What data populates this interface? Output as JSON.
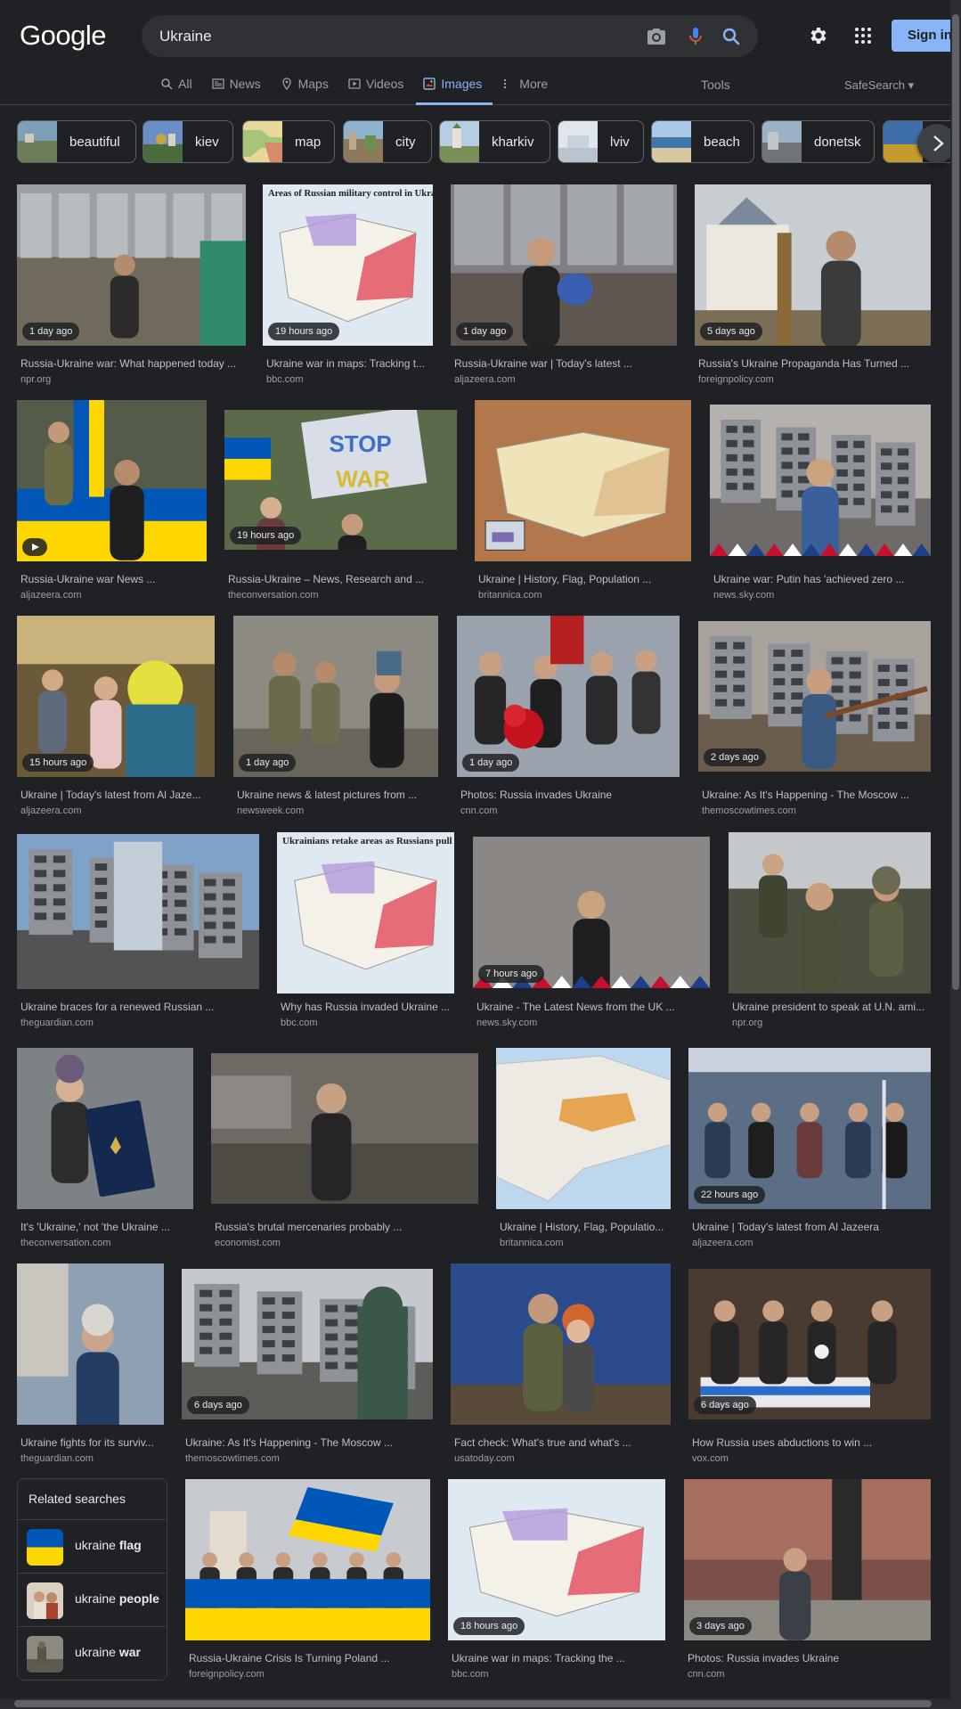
{
  "logo": "Google",
  "search": {
    "query": "Ukraine"
  },
  "header": {
    "signin_label": "Sign in",
    "tools_label": "Tools",
    "safesearch_label": "SafeSearch"
  },
  "tabs": [
    {
      "label": "All",
      "icon": "search-icon"
    },
    {
      "label": "News",
      "icon": "news-icon"
    },
    {
      "label": "Maps",
      "icon": "map-pin-icon"
    },
    {
      "label": "Videos",
      "icon": "video-icon"
    },
    {
      "label": "Images",
      "icon": "image-icon",
      "active": true
    },
    {
      "label": "More",
      "icon": "more-vert-icon"
    }
  ],
  "chips": [
    "beautiful",
    "kiev",
    "map",
    "city",
    "kharkiv",
    "lviv",
    "beach",
    "donetsk"
  ],
  "results": [
    {
      "title": "Russia-Ukraine war: What happened today ...",
      "domain": "npr.org",
      "badge": "1 day ago"
    },
    {
      "title": "Ukraine war in maps: Tracking t...",
      "domain": "bbc.com",
      "badge": "19 hours ago",
      "img_text": "Areas of Russian military control in Ukraine"
    },
    {
      "title": "Russia-Ukraine war | Today's latest ...",
      "domain": "aljazeera.com",
      "badge": "1 day ago"
    },
    {
      "title": "Russia's Ukraine Propaganda Has Turned ...",
      "domain": "foreignpolicy.com",
      "badge": "5 days ago"
    },
    {
      "title": "Russia-Ukraine war News ...",
      "domain": "aljazeera.com",
      "badge": ""
    },
    {
      "title": "Russia-Ukraine – News, Research and ...",
      "domain": "theconversation.com",
      "badge": "19 hours ago",
      "img_text": "STOP the WAR"
    },
    {
      "title": "Ukraine | History, Flag, Population ...",
      "domain": "britannica.com",
      "badge": ""
    },
    {
      "title": "Ukraine war: Putin has 'achieved zero ...",
      "domain": "news.sky.com",
      "badge": ""
    },
    {
      "title": "Ukraine | Today's latest from Al Jaze...",
      "domain": "aljazeera.com",
      "badge": "15 hours ago"
    },
    {
      "title": "Ukraine news & latest pictures from ...",
      "domain": "newsweek.com",
      "badge": "1 day ago"
    },
    {
      "title": "Photos: Russia invades Ukraine",
      "domain": "cnn.com",
      "badge": "1 day ago"
    },
    {
      "title": "Ukraine: As It's Happening - The Moscow ...",
      "domain": "themoscowtimes.com",
      "badge": "2 days ago"
    },
    {
      "title": "Ukraine braces for a renewed Russian ...",
      "domain": "theguardian.com",
      "badge": ""
    },
    {
      "title": "Why has Russia invaded Ukraine ...",
      "domain": "bbc.com",
      "badge": "",
      "img_text": "Ukrainians retake areas as Russians pull back"
    },
    {
      "title": "Ukraine - The Latest News from the UK ...",
      "domain": "news.sky.com",
      "badge": "7 hours ago"
    },
    {
      "title": "Ukraine president to speak at U.N. ami...",
      "domain": "npr.org",
      "badge": ""
    },
    {
      "title": "It's 'Ukraine,' not 'the Ukraine ...",
      "domain": "theconversation.com",
      "badge": ""
    },
    {
      "title": "Russia's brutal mercenaries probably ...",
      "domain": "economist.com",
      "badge": ""
    },
    {
      "title": "Ukraine | History, Flag, Populatio...",
      "domain": "britannica.com",
      "badge": ""
    },
    {
      "title": "Ukraine | Today's latest from Al Jazeera",
      "domain": "aljazeera.com",
      "badge": "22 hours ago"
    },
    {
      "title": "Ukraine fights for its surviv...",
      "domain": "theguardian.com",
      "badge": ""
    },
    {
      "title": "Ukraine: As It's Happening - The Moscow ...",
      "domain": "themoscowtimes.com",
      "badge": "6 days ago"
    },
    {
      "title": "Fact check: What's true and what's ...",
      "domain": "usatoday.com",
      "badge": ""
    },
    {
      "title": "How Russia uses abductions to win ...",
      "domain": "vox.com",
      "badge": "6 days ago"
    },
    {
      "title": "Russia-Ukraine Crisis Is Turning Poland ...",
      "domain": "foreignpolicy.com",
      "badge": ""
    },
    {
      "title": "Ukraine war in maps: Tracking the ...",
      "domain": "bbc.com",
      "badge": "18 hours ago"
    },
    {
      "title": "Photos: Russia invades Ukraine",
      "domain": "cnn.com",
      "badge": "3 days ago"
    }
  ],
  "related": {
    "heading": "Related searches",
    "items": [
      {
        "prefix": "ukraine",
        "bold": "flag"
      },
      {
        "prefix": "ukraine",
        "bold": "people"
      },
      {
        "prefix": "ukraine",
        "bold": "war"
      }
    ]
  },
  "colors": {
    "accent": "#8ab4f8",
    "background": "#202124",
    "flag_blue": "#0057b7",
    "flag_yellow": "#ffd700"
  }
}
